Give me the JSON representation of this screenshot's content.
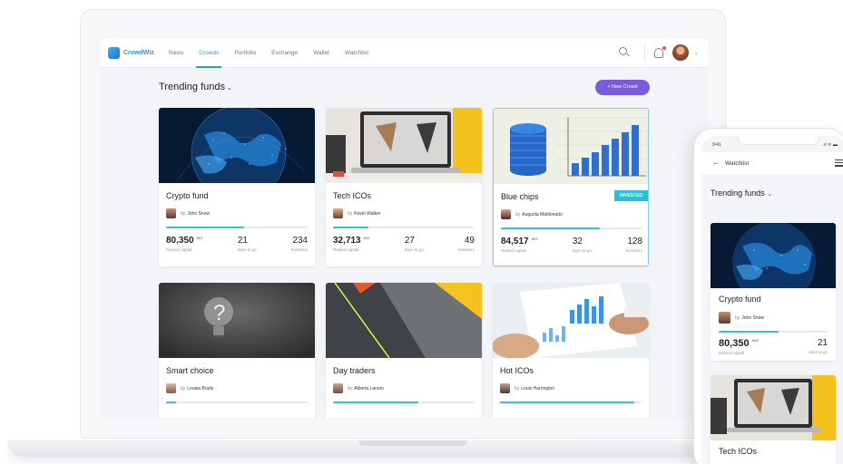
{
  "app": {
    "logo_text": "CrowdWiz",
    "nav": [
      {
        "label": "News",
        "active": false
      },
      {
        "label": "Crowds",
        "active": true
      },
      {
        "label": "Portfolio",
        "active": false
      },
      {
        "label": "Exchange",
        "active": false
      },
      {
        "label": "Wallet",
        "active": false
      },
      {
        "label": "Watchlist",
        "active": false
      }
    ],
    "section_title": "Trending funds",
    "section_chevron": "⌄",
    "new_button": "+ New Crowd",
    "cards": [
      {
        "title": "Crypto fund",
        "by": "by",
        "owner": "John Snow",
        "raised": "80,350",
        "unit": "WIZ",
        "raised_label": "Raised capital",
        "days": "21",
        "days_label": "days to go",
        "investors": "234",
        "investors_label": "Investors",
        "progress": 0.55
      },
      {
        "title": "Tech ICOs",
        "by": "by",
        "owner": "Kevin Walker",
        "raised": "32,713",
        "unit": "WIZ",
        "raised_label": "Raised capital",
        "days": "27",
        "days_label": "days to go",
        "investors": "49",
        "investors_label": "Investors",
        "progress": 0.25
      },
      {
        "title": "Blue chips",
        "by": "by",
        "owner": "Augusta Maldonado",
        "raised": "84,517",
        "unit": "WIZ",
        "raised_label": "Raised capital",
        "days": "32",
        "days_label": "days to go",
        "investors": "128",
        "investors_label": "Investors",
        "progress": 0.7,
        "badge": "INVESTED"
      },
      {
        "title": "Smart choice",
        "by": "by",
        "owner": "Louisa Brady",
        "progress": 0.07
      },
      {
        "title": "Day traders",
        "by": "by",
        "owner": "Alberta Larson",
        "progress": 0.6
      },
      {
        "title": "Hot ICOs",
        "by": "by",
        "owner": "Louis Harrington",
        "progress": 0.95
      }
    ]
  },
  "phone": {
    "time": "9:41",
    "signal": "..ıl ᯤ ▬",
    "back_icon": "←",
    "title": "Watchlist",
    "section_title": "Trending funds",
    "section_chevron": "⌄",
    "card": {
      "title": "Crypto fund",
      "by": "by",
      "owner": "John Snow",
      "raised": "80,350",
      "unit": "WIZ",
      "raised_label": "Raised capital",
      "days": "21",
      "days_label": "days to go",
      "progress": 0.55
    },
    "next_card_title": "Tech ICOs"
  },
  "colors": {
    "accent": "#2a9fd6",
    "button": "#7a5bde",
    "progress": "#33c1d4",
    "badge": "#2ac0d6"
  }
}
